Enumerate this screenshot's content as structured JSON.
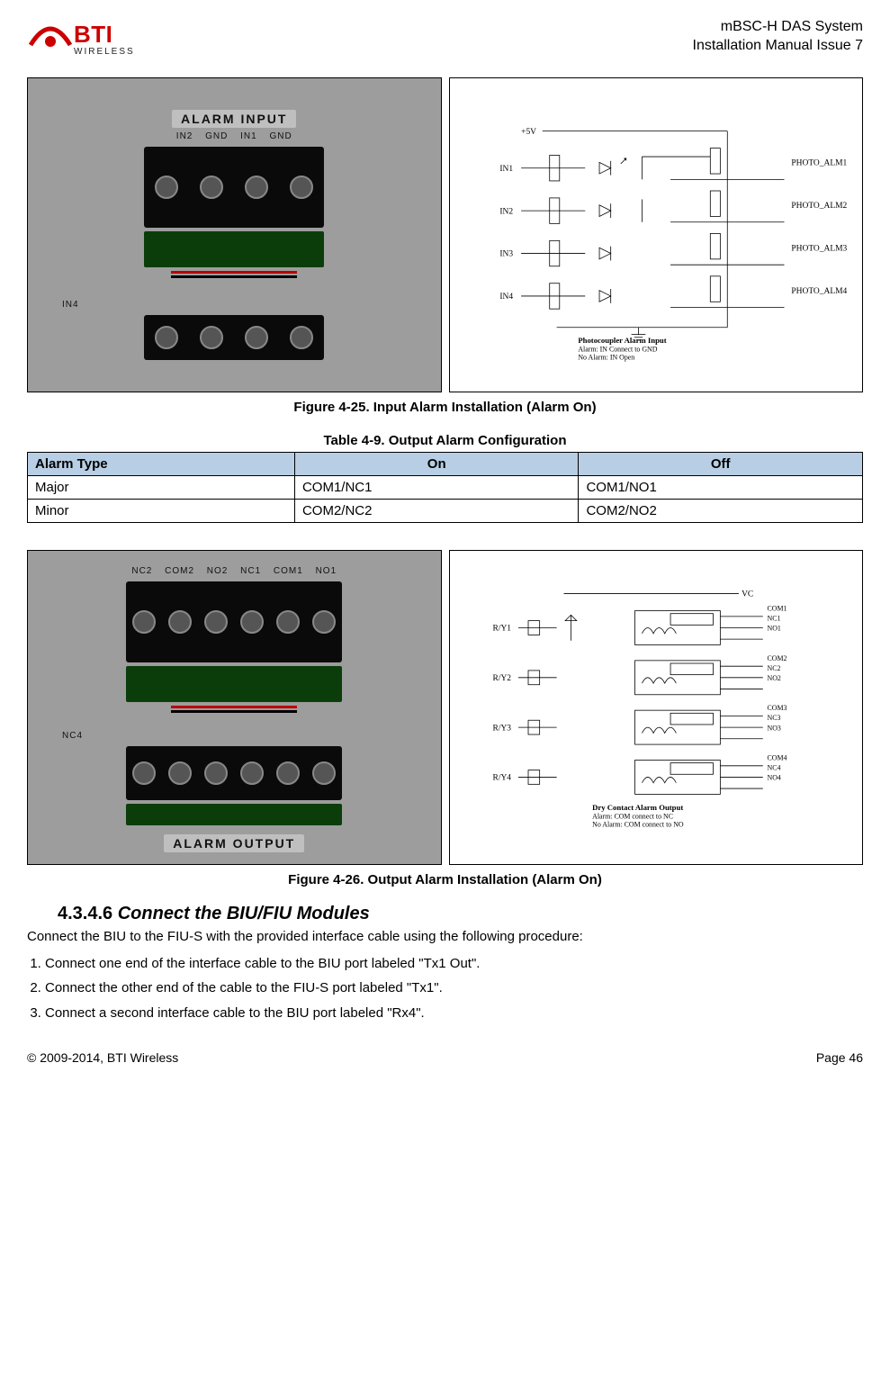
{
  "header": {
    "logo_main": "BTI",
    "logo_sub": "WIRELESS",
    "line1": "mBSC-H DAS System",
    "line2": "Installation Manual Issue 7"
  },
  "fig25": {
    "caption": "Figure 4-25. Input Alarm Installation (Alarm On)",
    "photo_plate": "ALARM INPUT",
    "photo_labels": "IN2   GND   IN1   GND",
    "photo_small": "IN4",
    "diag_v5": "+5V",
    "diag_in1": "IN1",
    "diag_in2": "IN2",
    "diag_in3": "IN3",
    "diag_in4": "IN4",
    "diag_p1": "PHOTO_ALM1",
    "diag_p2": "PHOTO_ALM2",
    "diag_p3": "PHOTO_ALM3",
    "diag_p4": "PHOTO_ALM4",
    "diag_title": "Photocoupler Alarm Input",
    "diag_l1": "Alarm: IN Connect to GND",
    "diag_l2": "No Alarm: IN Open"
  },
  "table9": {
    "caption": "Table 4-9. Output Alarm Configuration",
    "h1": "Alarm Type",
    "h2": "On",
    "h3": "Off",
    "r1c1": "Major",
    "r1c2": "COM1/NC1",
    "r1c3": "COM1/NO1",
    "r2c1": "Minor",
    "r2c2": "COM2/NC2",
    "r2c3": "COM2/NO2"
  },
  "fig26": {
    "caption": "Figure 4-26. Output Alarm Installation (Alarm On)",
    "photo_labels_top": "NC2 COM2 NO2   NC1 COM1 NO1",
    "photo_label_mid": "NC4",
    "photo_plate": "ALARM OUTPUT",
    "diag_vc": "VC",
    "diag_ry1": "R/Y1",
    "diag_ry2": "R/Y2",
    "diag_ry3": "R/Y3",
    "diag_ry4": "R/Y4",
    "diag_com1": "COM1",
    "diag_nc1": "NC1",
    "diag_no1": "NO1",
    "diag_com2": "COM2",
    "diag_nc2": "NC2",
    "diag_no2": "NO2",
    "diag_com3": "COM3",
    "diag_nc3": "NC3",
    "diag_no3": "NO3",
    "diag_com4": "COM4",
    "diag_nc4": "NC4",
    "diag_no4": "NO4",
    "diag_title": "Dry Contact Alarm Output",
    "diag_l1": "Alarm: COM connect to NC",
    "diag_l2": "No Alarm: COM connect to NO"
  },
  "section": {
    "num": "4.3.4.6",
    "title": " Connect the BIU/FIU Modules",
    "intro": "Connect the BIU to the FIU-S with the provided interface cable using the following procedure:",
    "step1": "Connect one end of the interface cable to the BIU port labeled \"Tx1 Out\".",
    "step2": "Connect the other end of the cable to the FIU-S port labeled \"Tx1\".",
    "step3": "Connect a second interface cable to the BIU port labeled \"Rx4\"."
  },
  "footer": {
    "left": "© 2009-2014, BTI Wireless",
    "right": "Page 46"
  }
}
